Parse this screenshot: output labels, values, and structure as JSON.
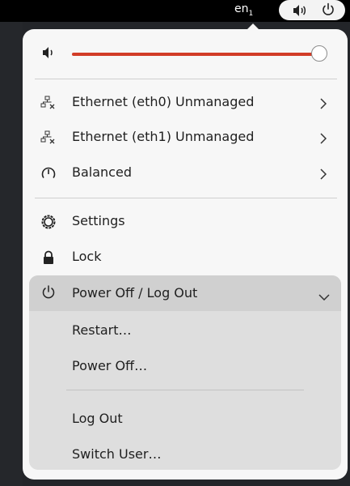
{
  "topbar": {
    "language_label": "en",
    "language_sub": "1",
    "volume_icon": "speaker-icon",
    "power_icon": "power-icon"
  },
  "menu": {
    "volume": {
      "icon": "speaker-icon",
      "level": 1.0,
      "accent_color": "#d23d28"
    },
    "network_items": [
      {
        "label": "Ethernet (eth0) Unmanaged",
        "icon": "wired-network-disconnected-icon"
      },
      {
        "label": "Ethernet (eth1) Unmanaged",
        "icon": "wired-network-disconnected-icon"
      }
    ],
    "power_mode": {
      "label": "Balanced",
      "icon": "power-profile-icon"
    },
    "settings_label": "Settings",
    "lock_label": "Lock",
    "power_section": {
      "label": "Power Off / Log Out",
      "items": [
        "Restart…",
        "Power Off…",
        "Log Out",
        "Switch User…"
      ]
    }
  }
}
